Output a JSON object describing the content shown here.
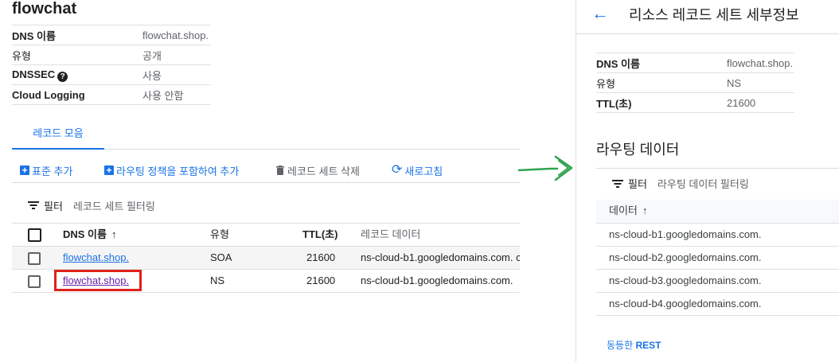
{
  "zone": {
    "title": "flowchat",
    "properties": [
      {
        "key": "DNS 이름",
        "value": "flowchat.shop."
      },
      {
        "key": "유형",
        "value": "공개"
      },
      {
        "key": "DNSSEC",
        "value": "사용"
      },
      {
        "key": "Cloud Logging",
        "value": "사용 안함"
      }
    ]
  },
  "tabs": [
    {
      "label": "레코드 모음"
    }
  ],
  "toolbar": {
    "add_standard": "표준 추가",
    "add_with_routing": "라우팅 정책을 포함하여 추가",
    "delete_record_set": "레코드 세트 삭제",
    "refresh": "새로고침"
  },
  "filter": {
    "label": "필터",
    "placeholder": "레코드 세트 필터링"
  },
  "records_table": {
    "columns": [
      "DNS 이름",
      "유형",
      "TTL(초)",
      "레코드 데이터"
    ],
    "rows": [
      {
        "dns_name": "flowchat.shop.",
        "type": "SOA",
        "ttl": "21600",
        "data": "ns-cloud-b1.googledomains.com. c"
      },
      {
        "dns_name": "flowchat.shop.",
        "type": "NS",
        "ttl": "21600",
        "data": "ns-cloud-b1.googledomains.com."
      }
    ]
  },
  "detail_panel": {
    "title": "리소스 레코드 세트 세부정보",
    "properties": [
      {
        "key": "DNS 이름",
        "value": "flowchat.shop."
      },
      {
        "key": "유형",
        "value": "NS"
      },
      {
        "key": "TTL(초)",
        "value": "21600"
      }
    ],
    "routing_section_title": "라우팅 데이터",
    "filter": {
      "label": "필터",
      "placeholder": "라우팅 데이터 필터링"
    },
    "routing_table": {
      "column": "데이터",
      "rows": [
        "ns-cloud-b1.googledomains.com.",
        "ns-cloud-b2.googledomains.com.",
        "ns-cloud-b3.googledomains.com.",
        "ns-cloud-b4.googledomains.com."
      ]
    },
    "rest_link": {
      "prefix": "동등한",
      "label": "REST"
    }
  },
  "colors": {
    "accent": "#1a73e8",
    "highlight": "#e0201b",
    "annotation_arrow": "#2ea44f"
  }
}
